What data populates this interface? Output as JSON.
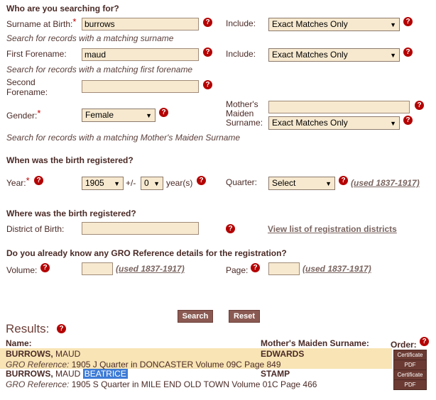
{
  "search": {
    "heading": "Who are you searching for?",
    "surname_label": "Surname at Birth:",
    "surname_value": "burrows",
    "include_label": "Include:",
    "include_surname": "Exact Matches Only",
    "surname_hint": "Search for records with a matching surname",
    "forename_label": "First Forename:",
    "forename_value": "maud",
    "include_forename": "Exact Matches Only",
    "forename_hint": "Search for records with a matching first forename",
    "second_label_1": "Second",
    "second_label_2": "Forename:",
    "gender_label": "Gender:",
    "gender_value": "Female",
    "mmn_label_1": "Mother's",
    "mmn_label_2": "Maiden",
    "mmn_label_3": "Surname:",
    "include_mmn": "Exact Matches Only",
    "mmn_hint": "Search for records with a matching Mother's Maiden Surname",
    "required_mark": "*",
    "help_mark": "?"
  },
  "when": {
    "heading": "When was the birth registered?",
    "year_label": "Year:",
    "year_value": "1905",
    "plusminus": "+/-",
    "range_value": "0",
    "years_label": "year(s)",
    "quarter_label": "Quarter:",
    "quarter_value": "Select",
    "used_link": "(used 1837-1917)"
  },
  "where": {
    "heading": "Where was the birth registered?",
    "district_label": "District of Birth:",
    "districts_link": "View list of registration districts"
  },
  "gro": {
    "heading": "Do you already know any GRO Reference details for the registration?",
    "volume_label": "Volume:",
    "page_label": "Page:",
    "used_link": "(used 1837-1917)"
  },
  "buttons": {
    "search": "Search",
    "reset": "Reset"
  },
  "results": {
    "title": "Results:",
    "col_name": "Name:",
    "col_mmn": "Mother's Maiden Surname:",
    "col_order": "Order:",
    "cert_label": "Certificate",
    "pdf_label": "PDF",
    "gro_prefix": "GRO Reference:",
    "rows": [
      {
        "surname": "BURROWS,",
        "forenames": "MAUD",
        "middle": "",
        "mmn": "EDWARDS",
        "gro_detail": "1905  J Quarter in DONCASTER  Volume 09C  Page 849"
      },
      {
        "surname": "BURROWS,",
        "forenames": "MAUD",
        "middle": "BEATRICE",
        "mmn": "STAMP",
        "gro_detail": "1905  S Quarter in MILE END OLD TOWN  Volume 01C  Page 466"
      }
    ]
  },
  "colors": {
    "accent": "#8a5a52",
    "input_bg": "#f7e9cf",
    "row_highlight": "#f8e4b4",
    "help": "#b40000"
  }
}
